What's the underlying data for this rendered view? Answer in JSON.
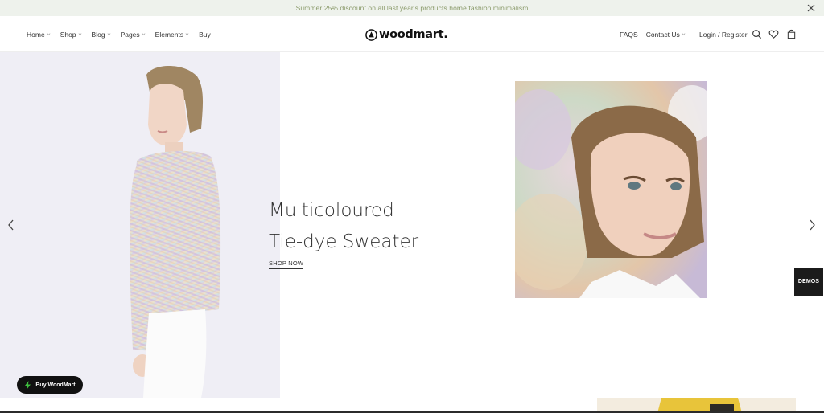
{
  "promo": {
    "text": "Summer 25% discount on all last year's products home fashion minimalism",
    "close_icon": "close-icon"
  },
  "nav": {
    "left": [
      "Home",
      "Shop",
      "Blog",
      "Pages",
      "Elements",
      "Buy"
    ],
    "right": [
      "FAQS",
      "Contact Us"
    ],
    "login": "Login / Register"
  },
  "logo": {
    "text": "woodmart."
  },
  "hero": {
    "title_line1": "Multicoloured",
    "title_line2": "Tie-dye Sweater",
    "cta": "SHOP NOW"
  },
  "demos_label": "DEMOS",
  "buy_button": "Buy WoodMart",
  "colors": {
    "promo_bg": "#eef2ec",
    "promo_text": "#8a9a6a",
    "hero_left_bg": "#efeef5",
    "dark": "#111111",
    "bolt_green": "#3fbf3f"
  }
}
